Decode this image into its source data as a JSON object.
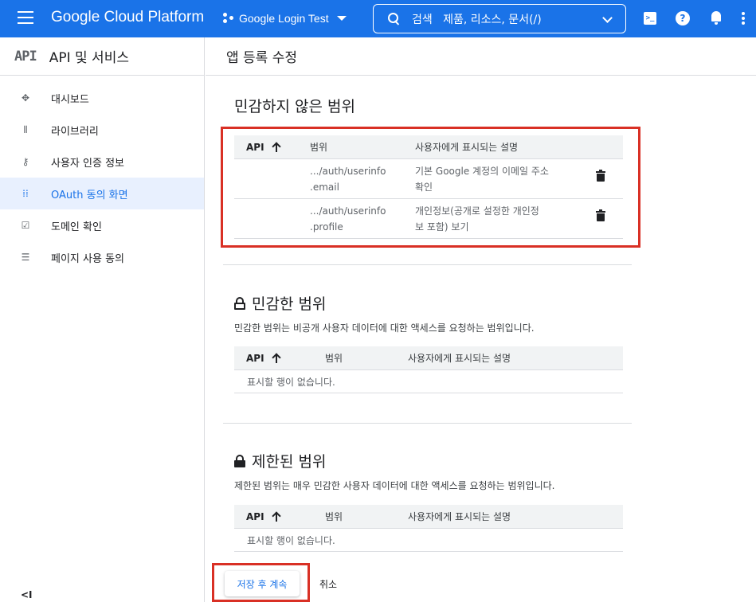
{
  "topbar": {
    "brand": "Google Cloud Platform",
    "project": "Google Login Test",
    "search_text": "검색   제품, 리소스, 문서(/)",
    "help_glyph": "?",
    "terminal_glyph": ">_",
    "accent_color": "#1a73e8"
  },
  "sidebar": {
    "logo": "API",
    "title": "API 및 서비스",
    "items": [
      {
        "label": "대시보드",
        "icon": "dashboard-icon",
        "active": false
      },
      {
        "label": "라이브러리",
        "icon": "library-icon",
        "active": false
      },
      {
        "label": "사용자 인증 정보",
        "icon": "key-icon",
        "active": false
      },
      {
        "label": "OAuth 동의 화면",
        "icon": "oauth-consent-icon",
        "active": true
      },
      {
        "label": "도메인 확인",
        "icon": "checkbox-icon",
        "active": false
      },
      {
        "label": "페이지 사용 동의",
        "icon": "settings-list-icon",
        "active": false
      }
    ],
    "collapse_glyph": "<I"
  },
  "main": {
    "page_title": "앱 등록 수정",
    "columns": {
      "api": "API",
      "scope": "범위",
      "desc": "사용자에게 표시되는 설명"
    },
    "nonsensitive": {
      "title": "민감하지 않은 범위",
      "rows": [
        {
          "scope_line1": ".../auth/userinfo",
          "scope_line2": ".email",
          "desc_line1": "기본 Google 계정의 이메일 주소",
          "desc_line2": "확인"
        },
        {
          "scope_line1": ".../auth/userinfo",
          "scope_line2": ".profile",
          "desc_line1": "개인정보(공개로 설정한 개인정",
          "desc_line2": "보 포함) 보기"
        }
      ]
    },
    "sensitive": {
      "title": "민감한 범위",
      "description": "민감한 범위는 비공개 사용자 데이터에 대한 액세스를 요청하는 범위입니다.",
      "empty": "표시할 행이 없습니다."
    },
    "restricted": {
      "title": "제한된 범위",
      "description": "제한된 범위는 매우 민감한 사용자 데이터에 대한 액세스를 요청하는 범위입니다.",
      "empty": "표시할 행이 없습니다."
    },
    "save_button": "저장 후 계속",
    "cancel_button": "취소",
    "highlight_color": "#d93025"
  }
}
